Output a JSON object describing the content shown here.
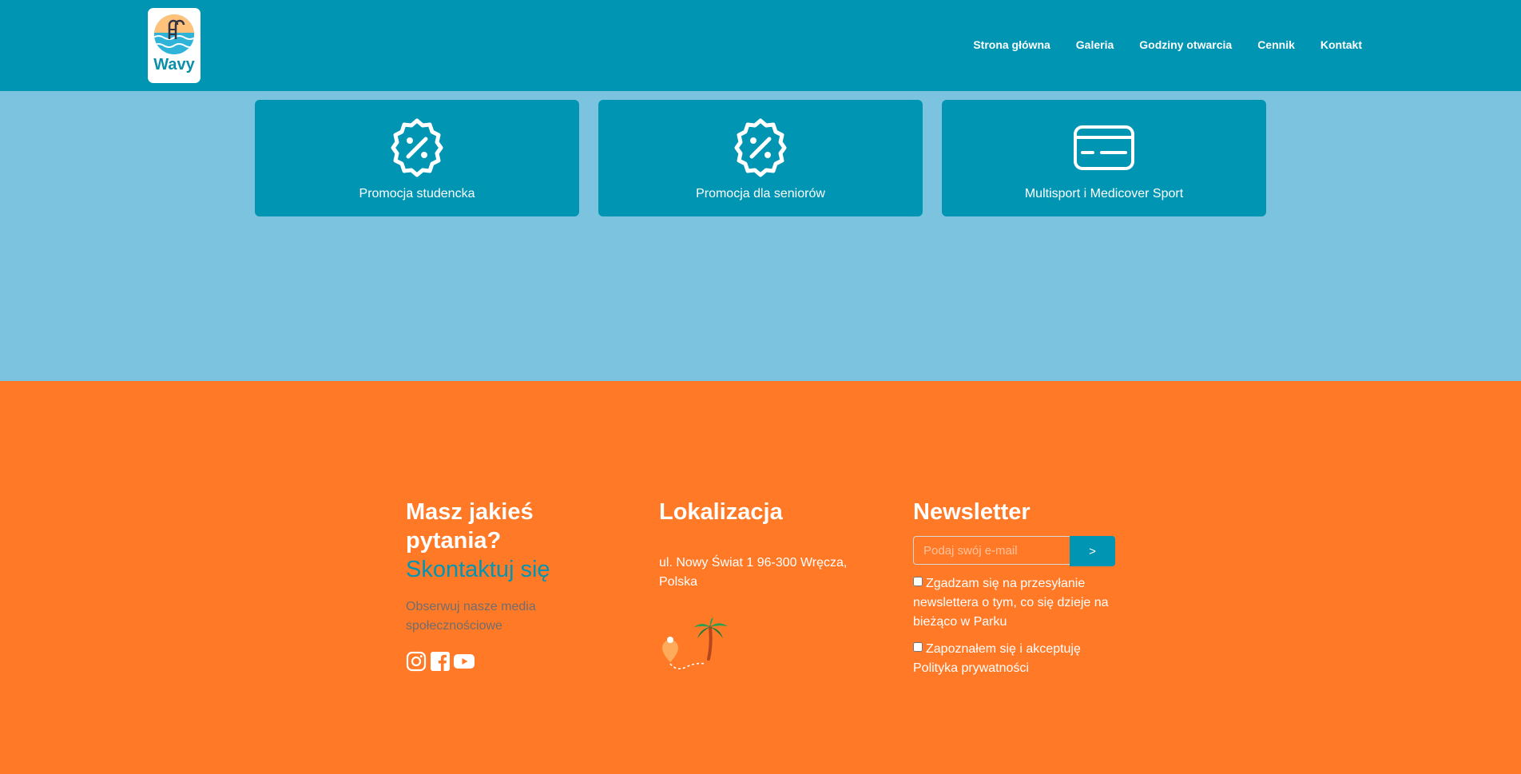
{
  "brand": {
    "name": "Wavy",
    "logo_icon": "pool-ladder-icon"
  },
  "nav": {
    "items": [
      {
        "label": "Strona główna"
      },
      {
        "label": "Galeria"
      },
      {
        "label": "Godziny otwarcia"
      },
      {
        "label": "Cennik"
      },
      {
        "label": "Kontakt"
      }
    ]
  },
  "promotions": [
    {
      "label": "Promocja studencka",
      "icon": "discount-badge-icon"
    },
    {
      "label": "Promocja dla seniorów",
      "icon": "discount-badge-icon"
    },
    {
      "label": "Multisport i Medicover Sport",
      "icon": "credit-card-icon"
    }
  ],
  "footer": {
    "contact": {
      "question": "Masz jakieś pytania?",
      "link_label": "Skontaktuj się",
      "social_text": "Obserwuj nasze media społecznościowe",
      "social_icons": [
        "instagram-icon",
        "facebook-icon",
        "youtube-icon"
      ]
    },
    "location": {
      "title": "Lokalizacja",
      "address": "ul. Nowy Świat 1 96-300 Wręcza, Polska",
      "illustration": "map-route-palm-icon"
    },
    "newsletter": {
      "title": "Newsletter",
      "email_placeholder": "Podaj swój e-mail",
      "email_value": "",
      "submit_label": ">",
      "consent_newsletter": "Zgadzam się na przesyłanie newslettera o tym, co się dzieje na bieżąco w Parku",
      "consent_privacy": "Zapoznałem się i akceptuję Polityka prywatności"
    }
  },
  "colors": {
    "navbar": "#0095b3",
    "page_background": "#7cc3df",
    "card": "#0095b3",
    "footer": "#ff7926",
    "accent_link": "#0095b3"
  }
}
